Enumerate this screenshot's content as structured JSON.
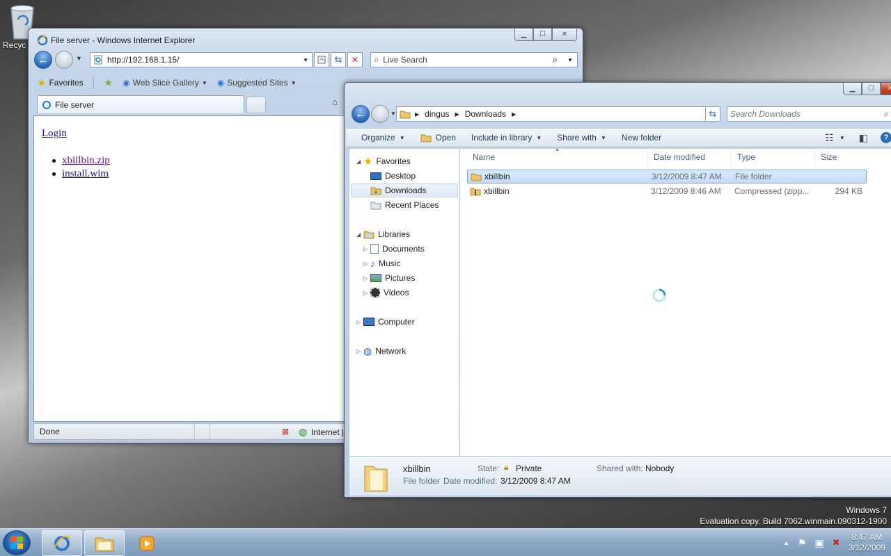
{
  "desktop": {
    "recycle_bin_label": "Recyc"
  },
  "ie": {
    "window_title": "File server - Windows Internet Explorer",
    "address": "http://192.168.1.15/",
    "search_placeholder": "Live Search",
    "favorites_label": "Favorites",
    "web_slice_label": "Web Slice Gallery",
    "suggested_sites_label": "Suggested Sites",
    "tab_title": "File server",
    "page": {
      "login_link": "Login",
      "files": [
        "xbillbin.zip",
        "install.wim"
      ]
    },
    "status_text": "Done",
    "zone_text": "Internet | P"
  },
  "explorer": {
    "breadcrumb": [
      "dingus",
      "Downloads"
    ],
    "search_placeholder": "Search Downloads",
    "commands": {
      "organize": "Organize",
      "open": "Open",
      "include_in_library": "Include in library",
      "share_with": "Share with",
      "new_folder": "New folder"
    },
    "nav": {
      "favorites": "Favorites",
      "desktop": "Desktop",
      "downloads": "Downloads",
      "recent_places": "Recent Places",
      "libraries": "Libraries",
      "documents": "Documents",
      "music": "Music",
      "pictures": "Pictures",
      "videos": "Videos",
      "computer": "Computer",
      "network": "Network"
    },
    "columns": {
      "name": "Name",
      "date_modified": "Date modified",
      "type": "Type",
      "size": "Size"
    },
    "files": [
      {
        "name": "xbillbin",
        "date": "3/12/2009 8:47 AM",
        "type": "File folder",
        "size": ""
      },
      {
        "name": "xbillbin",
        "date": "3/12/2009 8:46 AM",
        "type": "Compressed (zipp...",
        "size": "294 KB"
      }
    ],
    "details": {
      "name": "xbillbin",
      "kind": "File folder",
      "state_label": "State:",
      "state_value": "Private",
      "date_label": "Date modified:",
      "date_value": "3/12/2009 8:47 AM",
      "shared_label": "Shared with:",
      "shared_value": "Nobody"
    }
  },
  "watermark": {
    "line1": "Windows 7",
    "line2": "Evaluation copy. Build 7062.winmain.090312-1900"
  },
  "taskbar": {
    "time": "8:47 AM",
    "date": "3/12/2009"
  },
  "colors": {
    "accent": "#2c6cc0",
    "selection": "#c1dcfc",
    "link": "#1a0dab"
  }
}
